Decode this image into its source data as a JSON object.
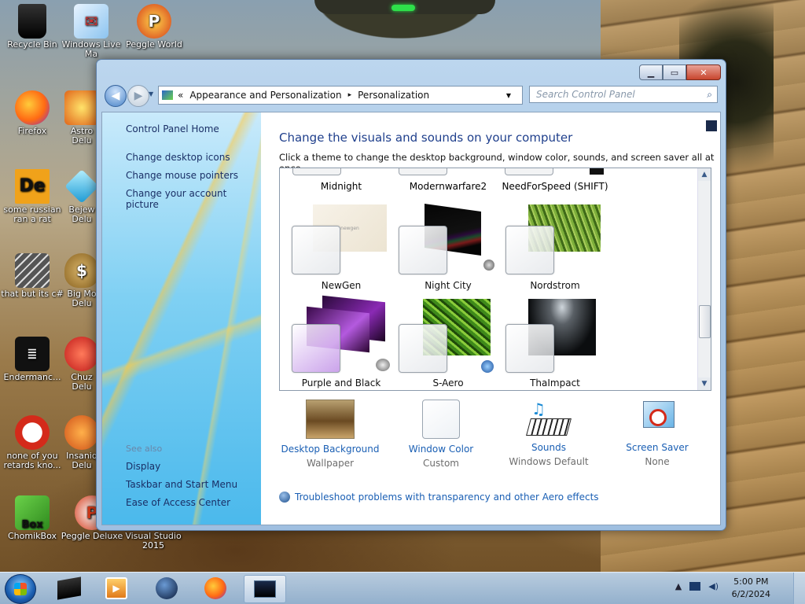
{
  "desktop": {
    "icons": [
      {
        "label": "Recycle Bin",
        "icon": "recycle-bin-icon"
      },
      {
        "label": "Windows Live Ma",
        "icon": "mail-icon"
      },
      {
        "label": "Peggle World",
        "icon": "peggle-icon"
      },
      {
        "label": "Firefox",
        "icon": "firefox-icon"
      },
      {
        "label": "Astro Delu",
        "icon": "game-icon"
      },
      {
        "label": "some russian ran a rat",
        "icon": "de-icon"
      },
      {
        "label": "Bejew Delu",
        "icon": "gem-icon"
      },
      {
        "label": "that but its c#",
        "icon": "windows-stack-icon"
      },
      {
        "label": "Big Mo Delu",
        "icon": "money-bag-icon"
      },
      {
        "label": "Endermanc...",
        "icon": "console-icon"
      },
      {
        "label": "Chuz Delu",
        "icon": "game-icon"
      },
      {
        "label": "none of you retards kno...",
        "icon": "dragon-icon"
      },
      {
        "label": "Insaniq Delu",
        "icon": "game-icon"
      },
      {
        "label": "ChomikBox",
        "icon": "hamster-icon"
      },
      {
        "label": "Peggle Deluxe",
        "icon": "peggle-icon"
      },
      {
        "label": "Visual Studio 2015",
        "icon": "visual-studio-icon"
      }
    ]
  },
  "window": {
    "breadcrumb": {
      "sep": "«",
      "part1": "Appearance and Personalization",
      "arrow": "▸",
      "part2": "Personalization"
    },
    "search_placeholder": "Search Control Panel",
    "left_pane": {
      "home": "Control Panel Home",
      "links": [
        "Change desktop icons",
        "Change mouse pointers",
        "Change your account picture"
      ],
      "see_also": "See also",
      "see_also_links": [
        "Display",
        "Taskbar and Start Menu",
        "Ease of Access Center"
      ]
    },
    "main": {
      "title": "Change the visuals and sounds on your computer",
      "description": "Click a theme to change the desktop background, window color, sounds, and screen saver all at once.",
      "themes": [
        {
          "name": "Midnight"
        },
        {
          "name": "Modernwarfare2"
        },
        {
          "name": "NeedForSpeed (SHIFT)"
        },
        {
          "name": "NewGen",
          "preview_text": "newgen"
        },
        {
          "name": "Night City"
        },
        {
          "name": "Nordstrom"
        },
        {
          "name": "Purple and Black"
        },
        {
          "name": "S-Aero"
        },
        {
          "name": "ThaImpact"
        }
      ],
      "settings": [
        {
          "label": "Desktop Background",
          "sub": "Wallpaper"
        },
        {
          "label": "Window Color",
          "sub": "Custom"
        },
        {
          "label": "Sounds",
          "sub": "Windows Default"
        },
        {
          "label": "Screen Saver",
          "sub": "None"
        }
      ],
      "troubleshoot": "Troubleshoot problems with transparency and other Aero effects"
    }
  },
  "taskbar": {
    "time": "5:00 PM",
    "date": "6/2/2024"
  }
}
